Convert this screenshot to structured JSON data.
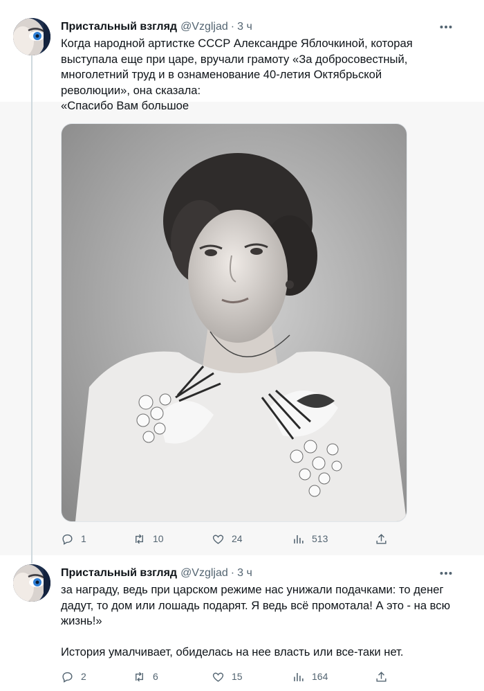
{
  "tweets": [
    {
      "author": {
        "name": "Пристальный взгляд",
        "handle": "@Vzgljad",
        "dot": "·",
        "time": "3 ч"
      },
      "lines": [
        "Когда народной артистке СССР Александре Яблочкиной, которая",
        "выступала еще при царе, вручали грамоту «За добросовестный,",
        "многолетний труд и в ознаменование 40-летия Октябрьской",
        "революции», она сказала:",
        "«Спасибо Вам большое"
      ],
      "actions": {
        "replies": "1",
        "reposts": "10",
        "likes": "24",
        "views": "513"
      }
    },
    {
      "author": {
        "name": "Пристальный взгляд",
        "handle": "@Vzgljad",
        "dot": "·",
        "time": "3 ч"
      },
      "lines": [
        "за награду, ведь при царском режиме нас унижали подачками: то денег",
        "дадут, то дом или лошадь подарят. Я ведь всё промотала! А это - на всю",
        "жизнь!»",
        "",
        "История умалчивает, обиделась на нее власть или все-таки нет."
      ],
      "actions": {
        "replies": "2",
        "reposts": "6",
        "likes": "15",
        "views": "164"
      }
    }
  ],
  "icons": {
    "reply": "speech-bubble-icon",
    "repost": "repost-arrows-icon",
    "like": "heart-icon",
    "views": "bar-chart-icon",
    "share": "upload-arrow-icon",
    "more": "three-dots-icon"
  },
  "colors": {
    "text": "#0f1419",
    "secondary": "#536471",
    "band": "#f7f7f7",
    "divider": "#cfd9de"
  }
}
